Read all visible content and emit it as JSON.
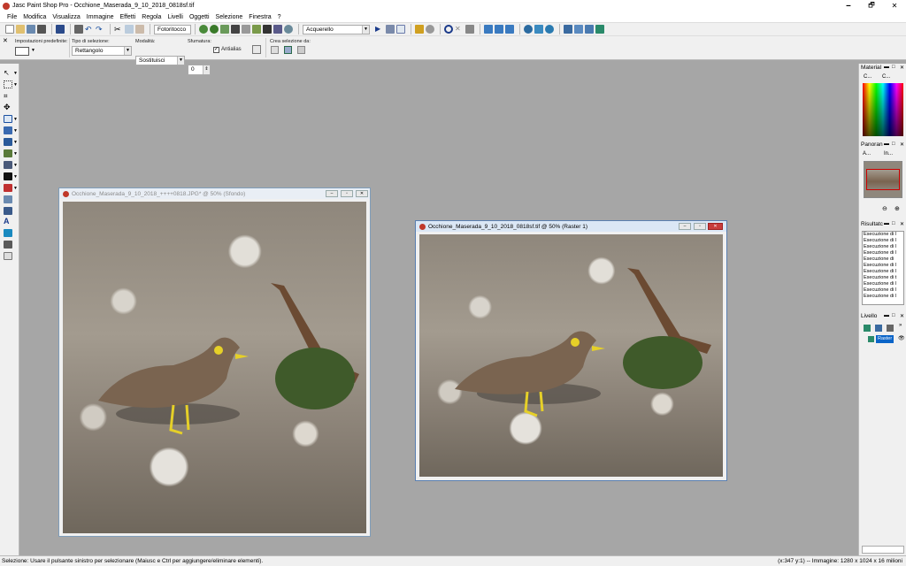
{
  "window": {
    "title": "Jasc Paint Shop Pro - Occhione_Maserada_9_10_2018_0818sf.tif",
    "minimize": "🗕",
    "maximize": "🗗",
    "close": "✕"
  },
  "menu": [
    "File",
    "Modifica",
    "Visualizza",
    "Immagine",
    "Effetti",
    "Regola",
    "Livelli",
    "Oggetti",
    "Selezione",
    "Finestra",
    "?"
  ],
  "toolbar1": {
    "preset1": "Fotoritocco",
    "preset2": "Acquerello"
  },
  "toolbar2": {
    "presets_label": "Impostazioni predefinite:",
    "selection_type_label": "Tipo di selezione:",
    "selection_type_value": "Rettangolo",
    "mode_label": "Modalità:",
    "mode_value": "Sostituisci",
    "feather_label": "Sfumatura:",
    "feather_value": "0",
    "antialias_label": "Antialias",
    "create_from_label": "Crea selezione da:"
  },
  "docs": [
    {
      "title": "Occhione_Maserada_9_10_2018_++++0818.JPG* @  50% (Sfondo)",
      "active": false
    },
    {
      "title": "Occhione_Maserada_9_10_2018_0818sf.tif @  50% (Raster 1)",
      "active": true
    }
  ],
  "panels": {
    "material": {
      "title": "Material",
      "tab1": "C...",
      "tab2": "C..."
    },
    "panorama": {
      "title": "Panoran",
      "tab1": "A...",
      "tab2": "In..."
    },
    "history": {
      "title": "Risultatc",
      "rows": [
        "Esecuzione di l",
        "Esecuzione di l",
        "Esecuzione di l",
        "Esecuzione di l",
        "Esecuzione di",
        "Esecuzione di l",
        "Esecuzione di l",
        "Esecuzione di t",
        "Esecuzione di l",
        "Esecuzione di l",
        "Esecuzione di l",
        "Esecuzione di l"
      ]
    },
    "layers": {
      "title": "Livello",
      "layer_name": "Raster"
    }
  },
  "status": {
    "left": "Selezione: Usare il pulsante sinistro per selezionare (Maiusc e Ctrl per aggiungere/eliminare elementi).",
    "right": "(x:347 y:1) -- Immagine:  1280 x 1024 x 16 milioni"
  },
  "colors": {
    "accent": "#0a64c8",
    "active_title": "#dbe7f5",
    "inactive_title": "#e9eef5",
    "close_red": "#c83c3c"
  }
}
